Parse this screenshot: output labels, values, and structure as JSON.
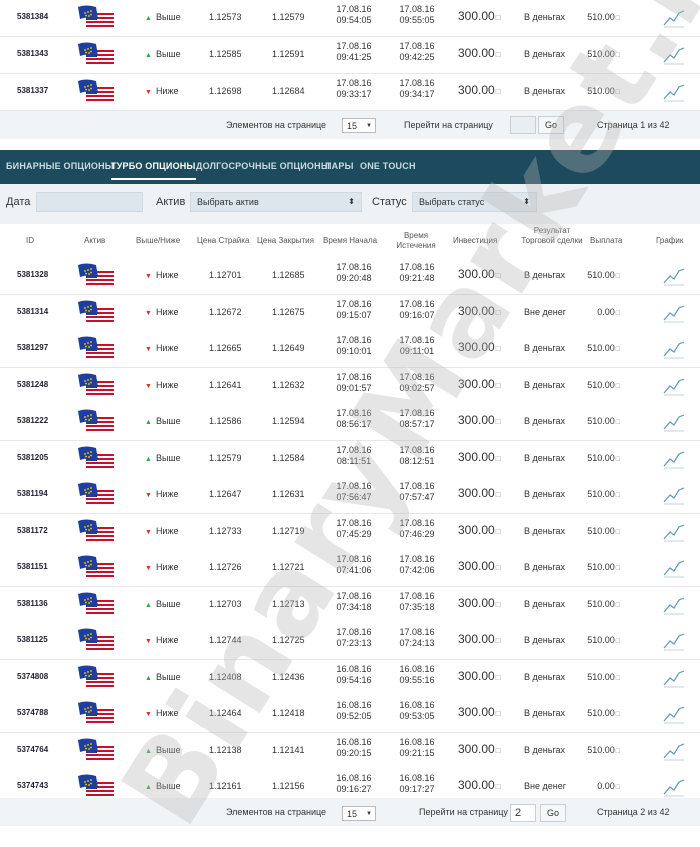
{
  "top_rows": [
    {
      "id": "5381384",
      "dir": "up",
      "dir_label": "Выше",
      "strike": "1.12573",
      "close": "1.12579",
      "start_date": "17.08.16",
      "start_time": "09:54:05",
      "end_date": "17.08.16",
      "end_time": "09:55:05",
      "investment": "300.00",
      "result": "В деньгах",
      "payout": "510.00"
    },
    {
      "id": "5381343",
      "dir": "up",
      "dir_label": "Выше",
      "strike": "1.12585",
      "close": "1.12591",
      "start_date": "17.08.16",
      "start_time": "09:41:25",
      "end_date": "17.08.16",
      "end_time": "09:42:25",
      "investment": "300.00",
      "result": "В деньгах",
      "payout": "510.00"
    },
    {
      "id": "5381337",
      "dir": "down",
      "dir_label": "Ниже",
      "strike": "1.12698",
      "close": "1.12684",
      "start_date": "17.08.16",
      "start_time": "09:33:17",
      "end_date": "17.08.16",
      "end_time": "09:34:17",
      "investment": "300.00",
      "result": "В деньгах",
      "payout": "510.00"
    }
  ],
  "pager_top": {
    "per_page_label": "Элементов на странице",
    "per_page_value": "15",
    "goto_label": "Перейти на страницу",
    "goto_value": "",
    "go_label": "Go",
    "page_info": "Страница 1 из 42"
  },
  "nav_tabs": [
    {
      "label": "БИНАРНЫЕ ОПЦИОНЫ",
      "active": false
    },
    {
      "label": "ТУРБО ОПЦИОНЫ",
      "active": true
    },
    {
      "label": "ДОЛГОСРОЧНЫЕ ОПЦИОНЫ",
      "active": false
    },
    {
      "label": "ПАРЫ",
      "active": false
    },
    {
      "label": "ONE TOUCH",
      "active": false
    }
  ],
  "filters": {
    "date_label": "Дата",
    "date_value": "",
    "asset_label": "Актив",
    "asset_value": "Выбрать актив",
    "status_label": "Статус",
    "status_value": "Выбрать статус"
  },
  "columns": [
    "ID",
    "Актив",
    "Выше/Ниже",
    "Цена Страйка",
    "Цена Закрытия",
    "Время Начала",
    "Время Истечения",
    "Инвестиция",
    "Результат Торговой сделки",
    "Выплата",
    "График"
  ],
  "rows": [
    {
      "id": "5381328",
      "dir": "down",
      "dir_label": "Ниже",
      "strike": "1.12701",
      "close": "1.12685",
      "start_date": "17.08.16",
      "start_time": "09:20:48",
      "end_date": "17.08.16",
      "end_time": "09:21:48",
      "investment": "300.00",
      "result": "В деньгах",
      "payout": "510.00"
    },
    {
      "id": "5381314",
      "dir": "down",
      "dir_label": "Ниже",
      "strike": "1.12672",
      "close": "1.12675",
      "start_date": "17.08.16",
      "start_time": "09:15:07",
      "end_date": "17.08.16",
      "end_time": "09:16:07",
      "investment": "300.00",
      "result": "Вне денег",
      "payout": "0.00"
    },
    {
      "id": "5381297",
      "dir": "down",
      "dir_label": "Ниже",
      "strike": "1.12665",
      "close": "1.12649",
      "start_date": "17.08.16",
      "start_time": "09:10:01",
      "end_date": "17.08.16",
      "end_time": "09:11:01",
      "investment": "300.00",
      "result": "В деньгах",
      "payout": "510.00"
    },
    {
      "id": "5381248",
      "dir": "down",
      "dir_label": "Ниже",
      "strike": "1.12641",
      "close": "1.12632",
      "start_date": "17.08.16",
      "start_time": "09:01:57",
      "end_date": "17.08.16",
      "end_time": "09:02:57",
      "investment": "300.00",
      "result": "В деньгах",
      "payout": "510.00"
    },
    {
      "id": "5381222",
      "dir": "up",
      "dir_label": "Выше",
      "strike": "1.12586",
      "close": "1.12594",
      "start_date": "17.08.16",
      "start_time": "08:56:17",
      "end_date": "17.08.16",
      "end_time": "08:57:17",
      "investment": "300.00",
      "result": "В деньгах",
      "payout": "510.00"
    },
    {
      "id": "5381205",
      "dir": "up",
      "dir_label": "Выше",
      "strike": "1.12579",
      "close": "1.12584",
      "start_date": "17.08.16",
      "start_time": "08:11:51",
      "end_date": "17.08.16",
      "end_time": "08:12:51",
      "investment": "300.00",
      "result": "В деньгах",
      "payout": "510.00"
    },
    {
      "id": "5381194",
      "dir": "down",
      "dir_label": "Ниже",
      "strike": "1.12647",
      "close": "1.12631",
      "start_date": "17.08.16",
      "start_time": "07:56:47",
      "end_date": "17.08.16",
      "end_time": "07:57:47",
      "investment": "300.00",
      "result": "В деньгах",
      "payout": "510.00"
    },
    {
      "id": "5381172",
      "dir": "down",
      "dir_label": "Ниже",
      "strike": "1.12733",
      "close": "1.12719",
      "start_date": "17.08.16",
      "start_time": "07:45:29",
      "end_date": "17.08.16",
      "end_time": "07:46:29",
      "investment": "300.00",
      "result": "В деньгах",
      "payout": "510.00"
    },
    {
      "id": "5381151",
      "dir": "down",
      "dir_label": "Ниже",
      "strike": "1.12726",
      "close": "1.12721",
      "start_date": "17.08.16",
      "start_time": "07:41:06",
      "end_date": "17.08.16",
      "end_time": "07:42:06",
      "investment": "300.00",
      "result": "В деньгах",
      "payout": "510.00"
    },
    {
      "id": "5381136",
      "dir": "up",
      "dir_label": "Выше",
      "strike": "1.12703",
      "close": "1.12713",
      "start_date": "17.08.16",
      "start_time": "07:34:18",
      "end_date": "17.08.16",
      "end_time": "07:35:18",
      "investment": "300.00",
      "result": "В деньгах",
      "payout": "510.00"
    },
    {
      "id": "5381125",
      "dir": "down",
      "dir_label": "Ниже",
      "strike": "1.12744",
      "close": "1.12725",
      "start_date": "17.08.16",
      "start_time": "07:23:13",
      "end_date": "17.08.16",
      "end_time": "07:24:13",
      "investment": "300.00",
      "result": "В деньгах",
      "payout": "510.00"
    },
    {
      "id": "5374808",
      "dir": "up",
      "dir_label": "Выше",
      "strike": "1.12408",
      "close": "1.12436",
      "start_date": "16.08.16",
      "start_time": "09:54:16",
      "end_date": "16.08.16",
      "end_time": "09:55:16",
      "investment": "300.00",
      "result": "В деньгах",
      "payout": "510.00"
    },
    {
      "id": "5374788",
      "dir": "down",
      "dir_label": "Ниже",
      "strike": "1.12464",
      "close": "1.12418",
      "start_date": "16.08.16",
      "start_time": "09:52:05",
      "end_date": "16.08.16",
      "end_time": "09:53:05",
      "investment": "300.00",
      "result": "В деньгах",
      "payout": "510.00"
    },
    {
      "id": "5374764",
      "dir": "up",
      "dir_label": "Выше",
      "strike": "1.12138",
      "close": "1.12141",
      "start_date": "16.08.16",
      "start_time": "09:20:15",
      "end_date": "16.08.16",
      "end_time": "09:21:15",
      "investment": "300.00",
      "result": "В деньгах",
      "payout": "510.00"
    },
    {
      "id": "5374743",
      "dir": "up",
      "dir_label": "Выше",
      "strike": "1.12161",
      "close": "1.12156",
      "start_date": "16.08.16",
      "start_time": "09:16:27",
      "end_date": "16.08.16",
      "end_time": "09:17:27",
      "investment": "300.00",
      "result": "Вне денег",
      "payout": "0.00"
    }
  ],
  "pager_bottom": {
    "per_page_label": "Элементов на странице",
    "per_page_value": "15",
    "goto_label": "Перейти на страницу",
    "goto_value": "2",
    "go_label": "Go",
    "page_info": "Страница 2 из 42"
  },
  "currency_symbol": "□",
  "watermark": "BinaryMarket.ru",
  "colors": {
    "nav_bg": "#1d4a5c",
    "up": "#2ea84a",
    "down": "#d9342b",
    "filter_bg": "#eef2f4",
    "pager_bg": "#f1f4f6"
  }
}
